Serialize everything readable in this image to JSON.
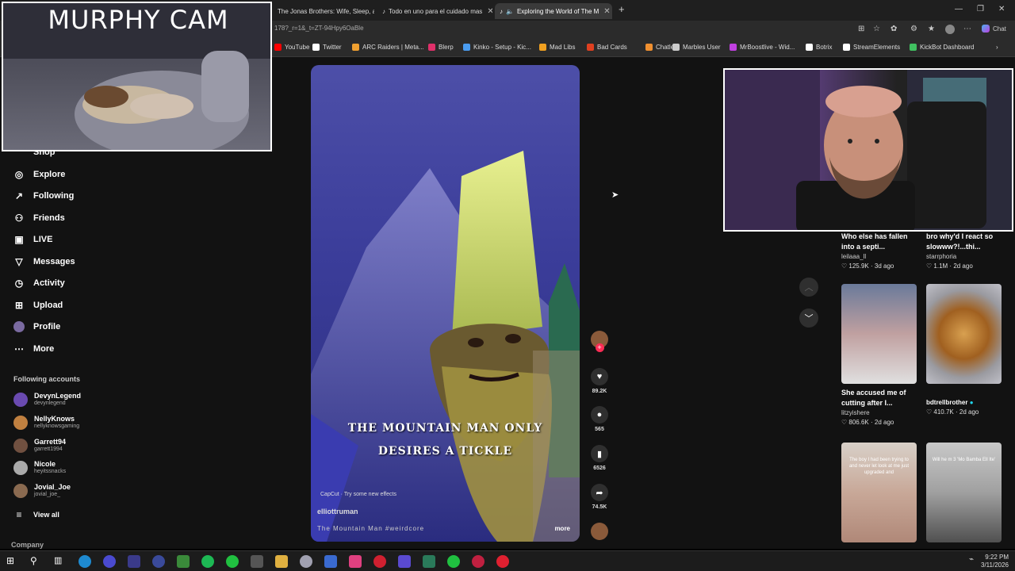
{
  "browser": {
    "tabs": [
      {
        "label": "The Jonas Brothers: Wife, Sleep, a"
      },
      {
        "label": "Todo en uno para el cuidado mas"
      },
      {
        "label": "Exploring the World of The M"
      }
    ],
    "url": "178?_r=1&_t=ZT-94Hpy6OaBle",
    "bookmarks": [
      {
        "label": "YouTube",
        "color": "#ff0000"
      },
      {
        "label": "Twitter",
        "color": "#ffffff"
      },
      {
        "label": "ARC Raiders | Meta...",
        "color": "#f0a030"
      },
      {
        "label": "Blerp",
        "color": "#e0306a"
      },
      {
        "label": "Kinko - Setup - Kic...",
        "color": "#4a9cf0"
      },
      {
        "label": "Mad Libs",
        "color": "#f0a020"
      },
      {
        "label": "Bad Cards",
        "color": "#e04020"
      },
      {
        "label": "Chatle",
        "color": "#f09030"
      },
      {
        "label": "Marbles User",
        "color": "#cccccc"
      },
      {
        "label": "MrBoostlive - Wid...",
        "color": "#c040e0"
      },
      {
        "label": "Botrix",
        "color": "#ffffff"
      },
      {
        "label": "StreamElements",
        "color": "#ffffff"
      },
      {
        "label": "KickBot Dashboard",
        "color": "#40c060"
      }
    ],
    "chat_label": "Chat"
  },
  "sidebar": {
    "partial_top": "Shop",
    "nav": [
      {
        "label": "Explore",
        "icon": "compass-icon"
      },
      {
        "label": "Following",
        "icon": "arrow-icon"
      },
      {
        "label": "Friends",
        "icon": "people-icon"
      },
      {
        "label": "LIVE",
        "icon": "live-icon"
      },
      {
        "label": "Messages",
        "icon": "send-icon"
      },
      {
        "label": "Activity",
        "icon": "bell-icon"
      },
      {
        "label": "Upload",
        "icon": "upload-icon"
      },
      {
        "label": "Profile",
        "icon": "avatar-icon"
      },
      {
        "label": "More",
        "icon": "more-icon"
      }
    ],
    "following_header": "Following accounts",
    "accounts": [
      {
        "name": "DevynLegend",
        "handle": "devynlegend",
        "color": "#6a4ab0"
      },
      {
        "name": "NellyKnows",
        "handle": "nellyknowsgaming",
        "color": "#c08040"
      },
      {
        "name": "Garrett94",
        "handle": "garrett1994",
        "color": "#705040"
      },
      {
        "name": "Nicole",
        "handle": "heyitssnacks",
        "color": "#aaaaaa"
      },
      {
        "name": "Jovial_Joe",
        "handle": "jovial_joe_",
        "color": "#8a6a50"
      }
    ],
    "view_all": "View all",
    "company": "Company"
  },
  "video": {
    "caption_line1": "THE MOUNTAIN MAN ONLY",
    "caption_line2": "DESIRES A TICKLE",
    "capcut": "CapCut · Try some new effects",
    "author": "elliottruman",
    "description": "The Mountain Man #weirdcore",
    "more": "more"
  },
  "actions": {
    "likes": "89.2K",
    "comments": "565",
    "saves": "6526",
    "shares": "74.5K"
  },
  "grid": [
    {
      "title": "Who else has fallen into a septi...",
      "user": "leilaaa_ll",
      "likes": "125.9K",
      "age": "3d ago"
    },
    {
      "title": "bro why'd I react so slowww?!...thi...",
      "user": "starrphoria",
      "likes": "1.1M",
      "age": "2d ago"
    },
    {
      "title": "She accused me of cutting after I...",
      "user": "litzyishere",
      "likes": "806.6K",
      "age": "2d ago"
    },
    {
      "title": "",
      "user": "bdtrellbrother",
      "likes": "410.7K",
      "age": "2d ago"
    }
  ],
  "grid_thumb_texts": {
    "card5": "The boy I had been trying to and never let look at me just upgraded and",
    "card6": "Will he m 3 'Mo Bamba Ell Ite'"
  },
  "overlays": {
    "murphy_cam": "MURPHY CAM"
  },
  "taskbar": {
    "time": "9:22 PM",
    "date": "3/11/2026"
  }
}
